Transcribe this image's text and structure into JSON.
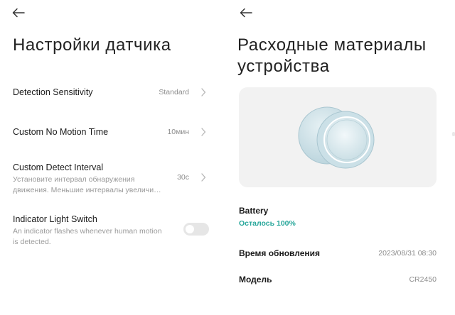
{
  "left": {
    "title": "Настройки датчика",
    "settings": [
      {
        "label": "Detection Sensitivity",
        "value": "Standard"
      },
      {
        "label": "Custom No Motion Time",
        "value": "10мин"
      },
      {
        "label": "Custom Detect Interval",
        "description": "Установите интервал обнаружения движения. Меньшие интервалы увеличи…",
        "value": "30с"
      },
      {
        "label": "Indicator Light Switch",
        "description": "An indicator flashes whenever human motion is detected.",
        "toggle_on": false
      }
    ]
  },
  "right": {
    "title": "Расходные материалы устройства",
    "battery": {
      "label": "Battery",
      "status": "Осталось 100%"
    },
    "update_time": {
      "label": "Время обновления",
      "value": "2023/08/31 08:30"
    },
    "model": {
      "label": "Модель",
      "value": "CR2450"
    }
  },
  "colors": {
    "accent_green": "#26a69a",
    "toggle_off": "#e6e6e6",
    "card_bg": "#f2f2f2",
    "device": "#cfe3ea"
  },
  "icons": {
    "back": "back-arrow-icon",
    "chevron": "chevron-right-icon"
  }
}
